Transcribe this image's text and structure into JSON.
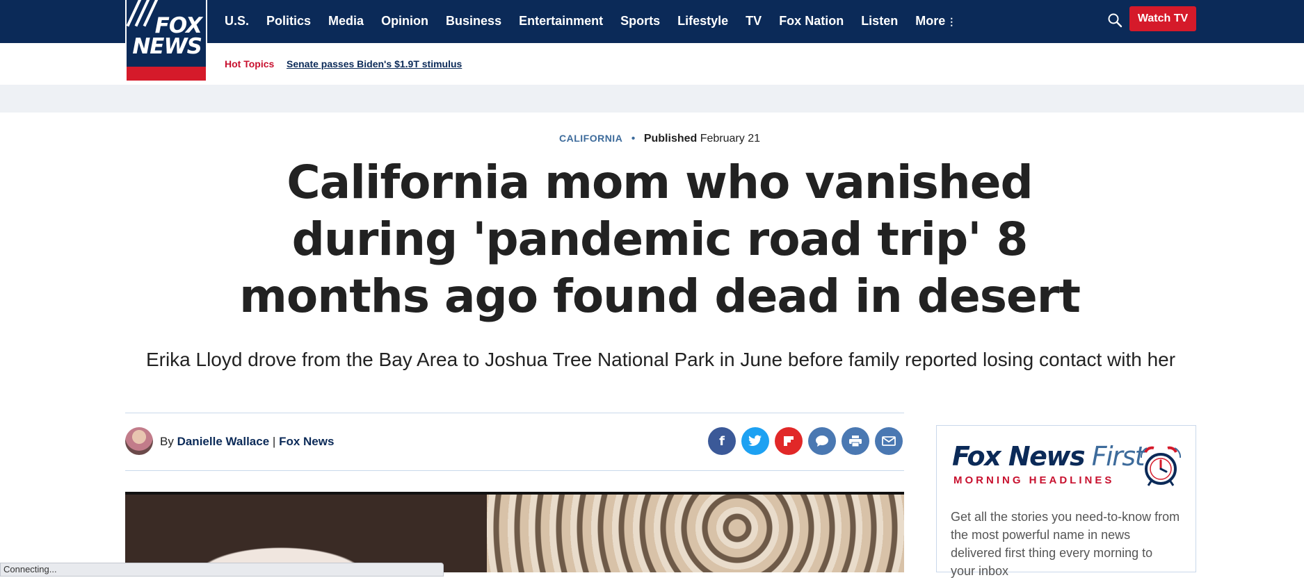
{
  "logo": {
    "text": "FOX NEWS"
  },
  "nav": {
    "items": [
      "U.S.",
      "Politics",
      "Media",
      "Opinion",
      "Business",
      "Entertainment",
      "Sports",
      "Lifestyle",
      "TV",
      "Fox Nation",
      "Listen",
      "More"
    ],
    "watch_label": "Watch TV"
  },
  "hot": {
    "label": "Hot Topics",
    "link": "Senate passes Biden's $1.9T stimulus"
  },
  "article": {
    "category": "CALIFORNIA",
    "published_label": "Published",
    "published_date": "February 21",
    "headline": "California mom who vanished during 'pandemic road trip' 8 months ago found dead in desert",
    "subhead": "Erika Lloyd drove from the Bay Area to Joshua Tree National Park in June before family reported losing contact with her",
    "by_label": "By",
    "author": "Danielle Wallace",
    "separator": "|",
    "outlet": "Fox News"
  },
  "share": {
    "facebook_color": "#3b5998",
    "twitter_color": "#1da1f2",
    "flipboard_color": "#e12828",
    "comments_color": "#4a78b2",
    "print_color": "#4a78b2",
    "email_color": "#4a78b2"
  },
  "newsletter": {
    "title_bold": "Fox News",
    "title_thin": "First",
    "subtitle": "MORNING HEADLINES",
    "description": "Get all the stories you need-to-know from the most powerful name in news delivered first thing every morning to your inbox"
  },
  "status_bar": {
    "text": "Connecting..."
  }
}
